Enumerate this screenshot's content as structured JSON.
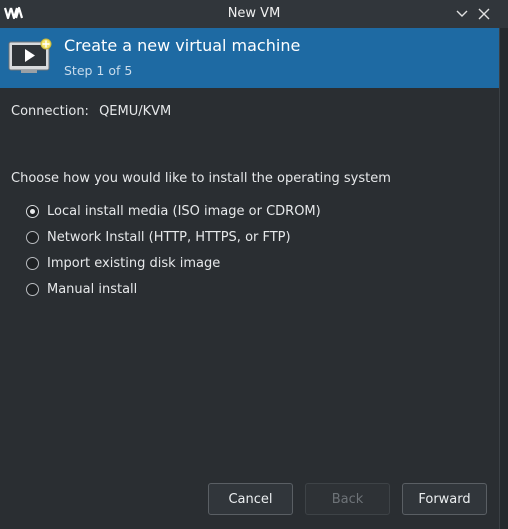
{
  "window": {
    "title": "New VM",
    "app_icon": "virt-manager-logo",
    "controls": [
      "chevron-down-icon",
      "close-icon"
    ]
  },
  "header": {
    "title": "Create a new virtual machine",
    "step": "Step 1 of 5",
    "icon": "vm-monitor-icon",
    "background": "#1e6aa3"
  },
  "connection": {
    "label": "Connection:",
    "value": "QEMU/KVM"
  },
  "install": {
    "prompt": "Choose how you would like to install the operating system",
    "options": [
      {
        "label": "Local install media (ISO image or CDROM)",
        "selected": true
      },
      {
        "label": "Network Install (HTTP, HTTPS, or FTP)",
        "selected": false
      },
      {
        "label": "Import existing disk image",
        "selected": false
      },
      {
        "label": "Manual install",
        "selected": false
      }
    ]
  },
  "buttons": {
    "cancel": "Cancel",
    "back": "Back",
    "forward": "Forward",
    "back_enabled": false
  }
}
